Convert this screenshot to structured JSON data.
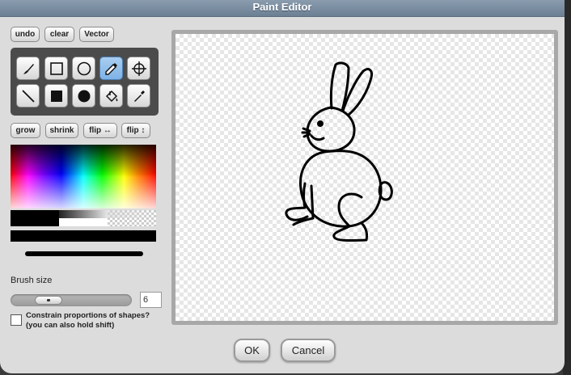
{
  "window": {
    "title": "Paint Editor"
  },
  "toolbar": {
    "undo": "undo",
    "clear": "clear",
    "vector": "Vector"
  },
  "tools": [
    {
      "name": "brush-icon"
    },
    {
      "name": "rectangle-icon"
    },
    {
      "name": "ellipse-icon"
    },
    {
      "name": "eraser-icon",
      "selected": true
    },
    {
      "name": "crosshair-icon"
    },
    {
      "name": "line-icon"
    },
    {
      "name": "filled-rectangle-icon"
    },
    {
      "name": "filled-ellipse-icon"
    },
    {
      "name": "paint-bucket-icon"
    },
    {
      "name": "eyedropper-icon"
    }
  ],
  "transform": {
    "grow": "grow",
    "shrink": "shrink",
    "flip_h": "flip ↔",
    "flip_v": "flip ↕"
  },
  "colors": {
    "current": "#000000",
    "accent_selected": "#7eb3e6"
  },
  "brush": {
    "label": "Brush size",
    "value": "6"
  },
  "constrain": {
    "line1": "Constrain proportions of shapes?",
    "line2": "(you can also hold shift)",
    "checked": false
  },
  "footer": {
    "ok": "OK",
    "cancel": "Cancel"
  }
}
